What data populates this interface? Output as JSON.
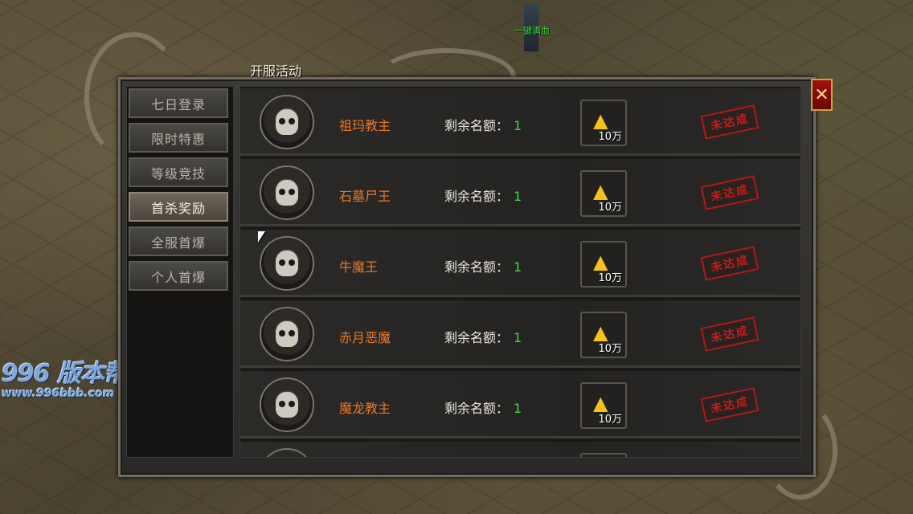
{
  "scene": {
    "character_name": "一键满血",
    "watermark_logo": "996 版本帮",
    "watermark_url": "www.996bbb.com"
  },
  "panel": {
    "title": "开服活动",
    "close_label": "✕"
  },
  "tabs": [
    {
      "label": "七日登录",
      "active": false
    },
    {
      "label": "限时特惠",
      "active": false
    },
    {
      "label": "等级竞技",
      "active": false
    },
    {
      "label": "首杀奖励",
      "active": true
    },
    {
      "label": "全服首爆",
      "active": false
    },
    {
      "label": "个人首爆",
      "active": false
    }
  ],
  "rows": [
    {
      "boss": "祖玛教主",
      "quota_label": "剩余名额：",
      "quota_value": "1",
      "reward_amount": "10万",
      "reward_icon": "gold-ingot-icon",
      "status": "未达成"
    },
    {
      "boss": "石墓尸王",
      "quota_label": "剩余名额：",
      "quota_value": "1",
      "reward_amount": "10万",
      "reward_icon": "gold-ingot-icon",
      "status": "未达成"
    },
    {
      "boss": "牛魔王",
      "quota_label": "剩余名额：",
      "quota_value": "1",
      "reward_amount": "10万",
      "reward_icon": "gold-ingot-icon",
      "status": "未达成"
    },
    {
      "boss": "赤月恶魔",
      "quota_label": "剩余名额：",
      "quota_value": "1",
      "reward_amount": "10万",
      "reward_icon": "gold-ingot-icon",
      "status": "未达成"
    },
    {
      "boss": "魔龙教主",
      "quota_label": "剩余名额：",
      "quota_value": "1",
      "reward_amount": "10万",
      "reward_icon": "gold-ingot-icon",
      "status": "未达成"
    }
  ],
  "colors": {
    "boss_name": "#e8782a",
    "quota_value": "#3fd93f",
    "stamp": "#d21e1e",
    "close_bg": "#a01010"
  }
}
